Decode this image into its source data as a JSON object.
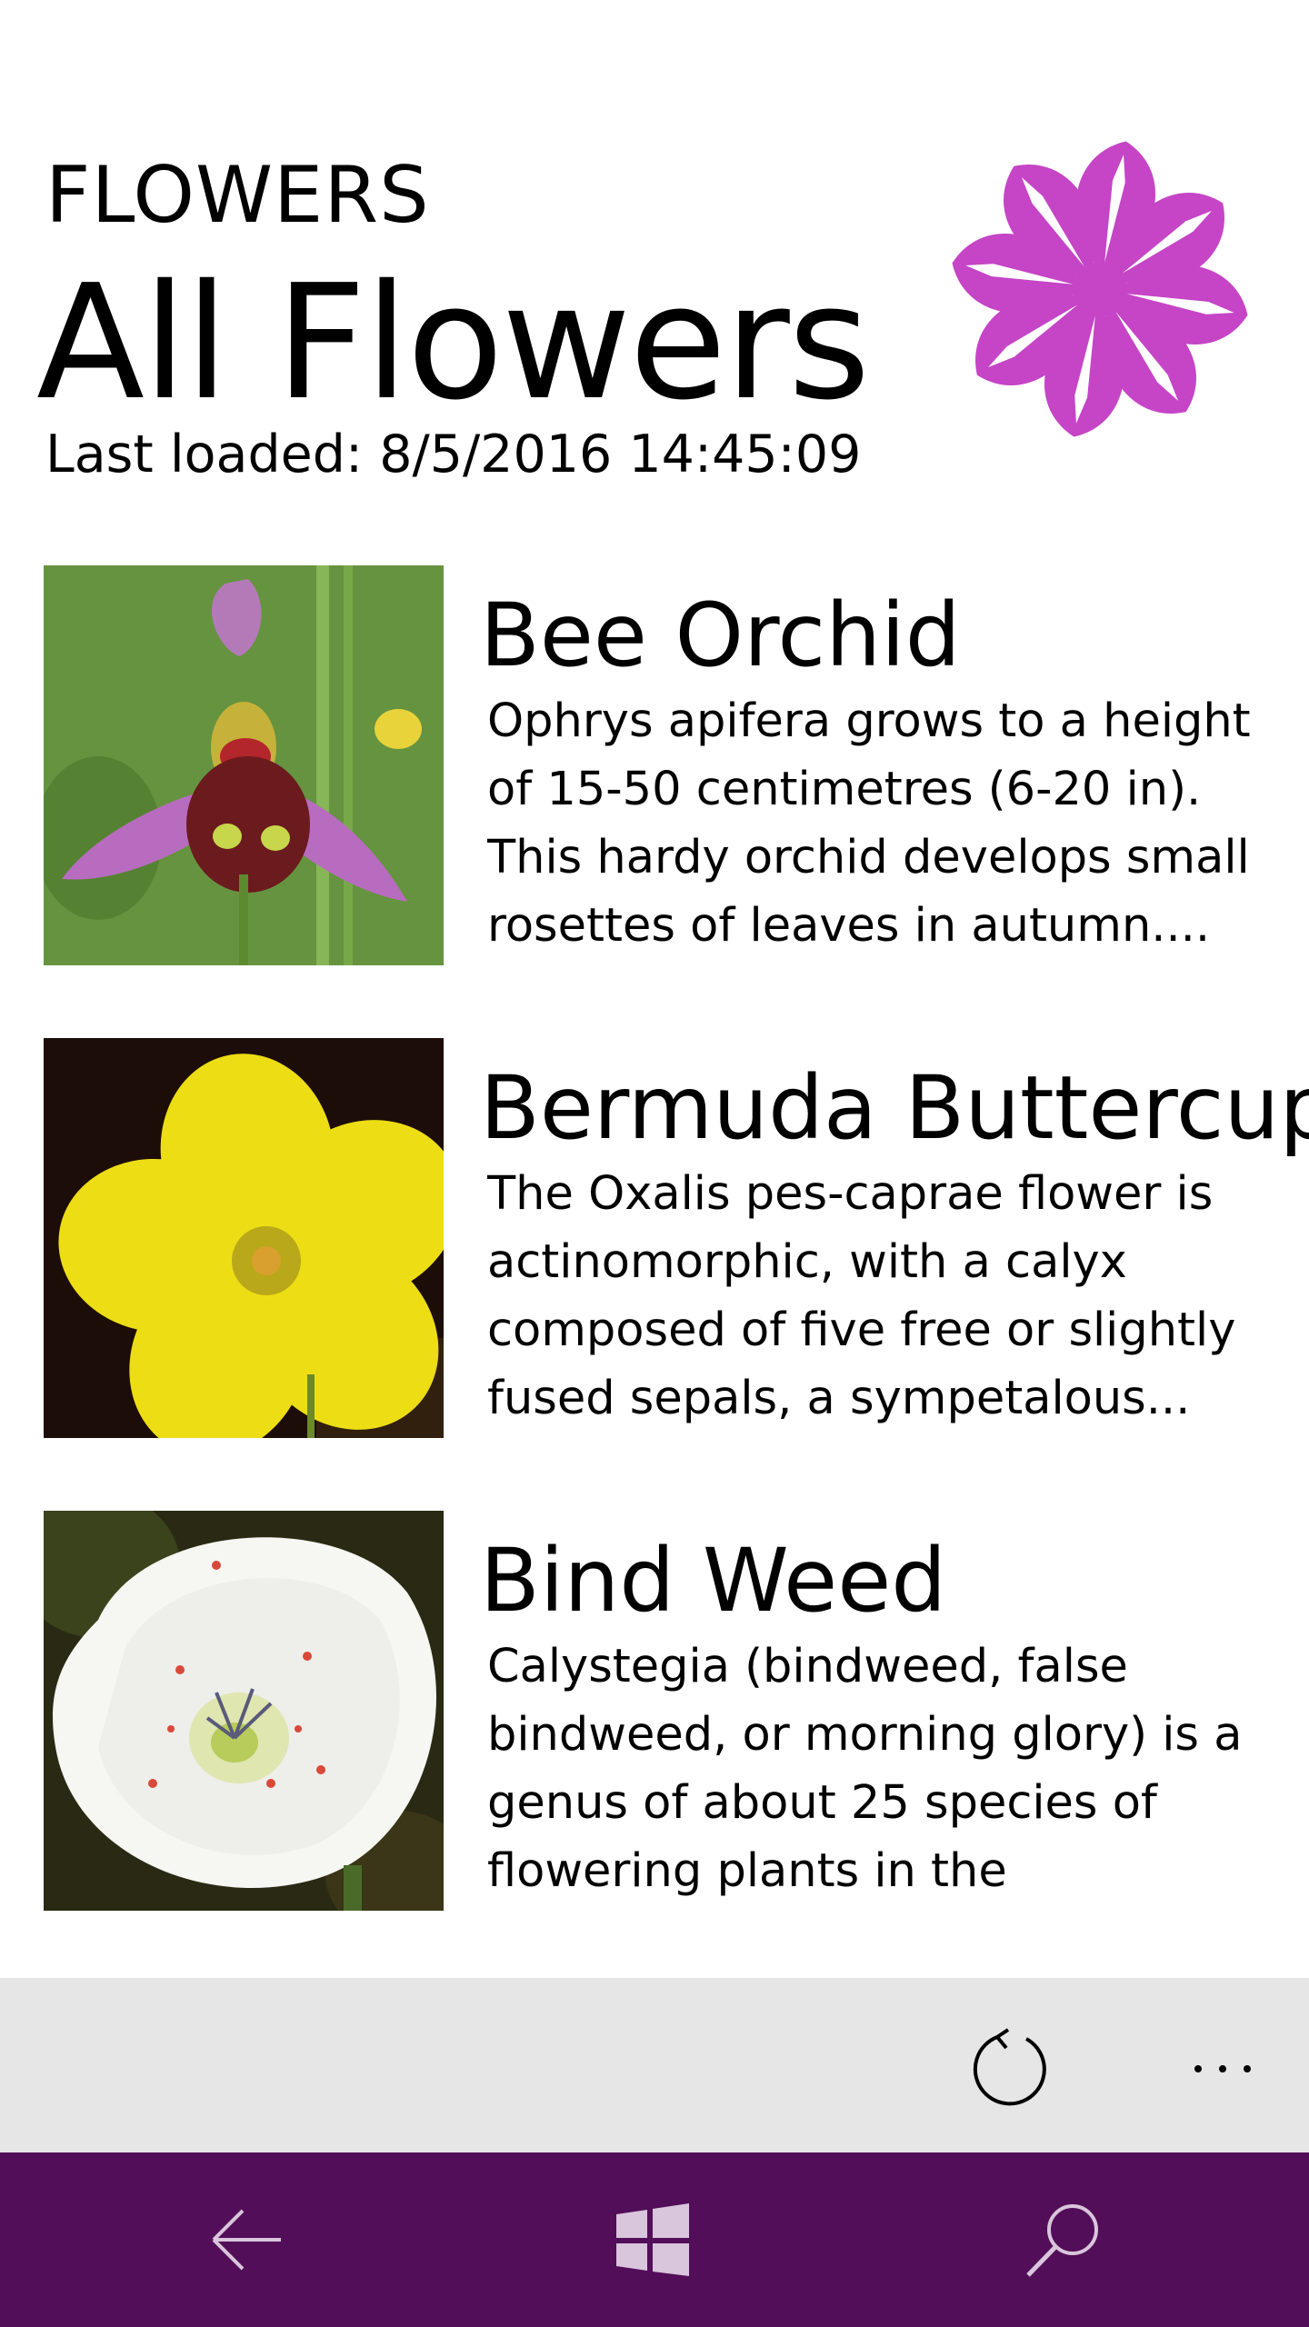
{
  "header": {
    "app_label": "FLOWERS",
    "page_title": "All Flowers",
    "last_loaded": "Last loaded: 8/5/2016 14:45:09",
    "logo_icon": "flower-logo-icon",
    "logo_color": "#c545c6"
  },
  "flowers": [
    {
      "name": "Bee Orchid",
      "description": "Ophrys apifera grows to a height of 15-50 centimetres (6-20 in). This hardy orchid develops small rosettes of leaves in autumn....",
      "image_icon": "bee-orchid-photo"
    },
    {
      "name": "Bermuda Buttercup",
      "description": "The Oxalis pes-caprae flower is actinomorphic, with a calyx composed of five free or slightly fused sepals, a sympetalous...",
      "image_icon": "bermuda-buttercup-photo"
    },
    {
      "name": "Bind Weed",
      "description": "Calystegia (bindweed, false bindweed, or morning glory) is a genus of about 25 species of flowering plants in the bindweed...",
      "image_icon": "bind-weed-photo"
    }
  ],
  "command_bar": {
    "refresh_icon": "refresh-icon",
    "more_icon": "more-icon",
    "more_label": "..."
  },
  "nav_bar": {
    "back_icon": "back-arrow-icon",
    "windows_icon": "windows-icon",
    "search_icon": "search-icon",
    "color": "#520e58"
  }
}
